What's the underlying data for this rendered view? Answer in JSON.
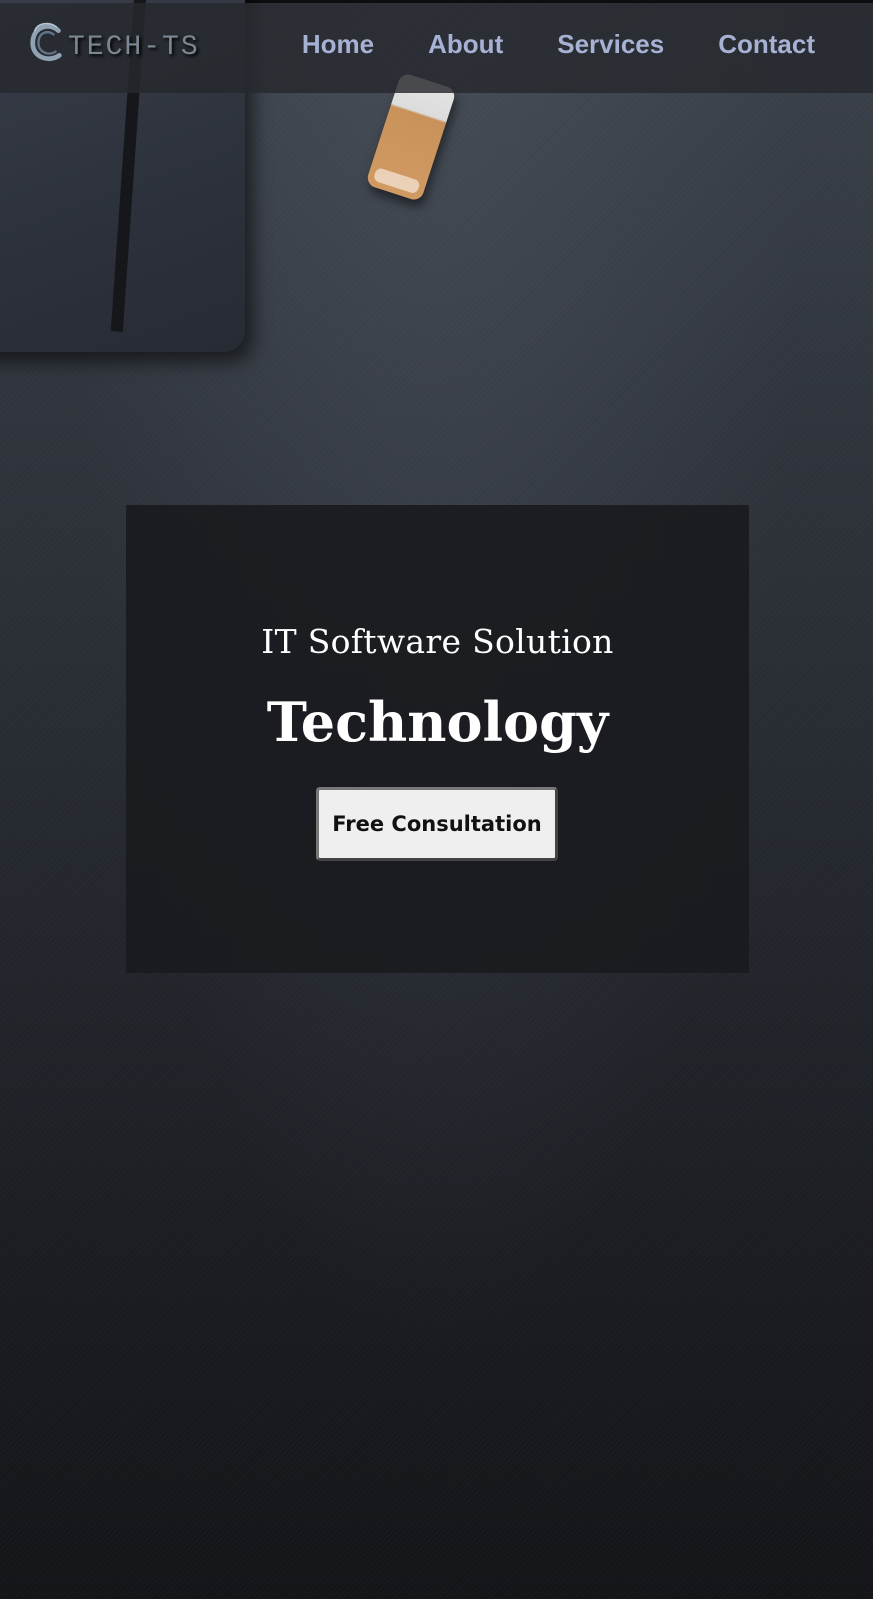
{
  "header": {
    "brand_name": "TECH-TS",
    "nav_items": [
      "Home",
      "About",
      "Services",
      "Contact"
    ]
  },
  "hero": {
    "subtitle": "IT Software Solution",
    "title": "Technology",
    "cta_label": "Free Consultation"
  },
  "colors": {
    "nav_link": "#a6b1d4",
    "brand_text": "#7b8894",
    "hero_card": "#1a1b1f",
    "cta_background": "#efefef"
  }
}
